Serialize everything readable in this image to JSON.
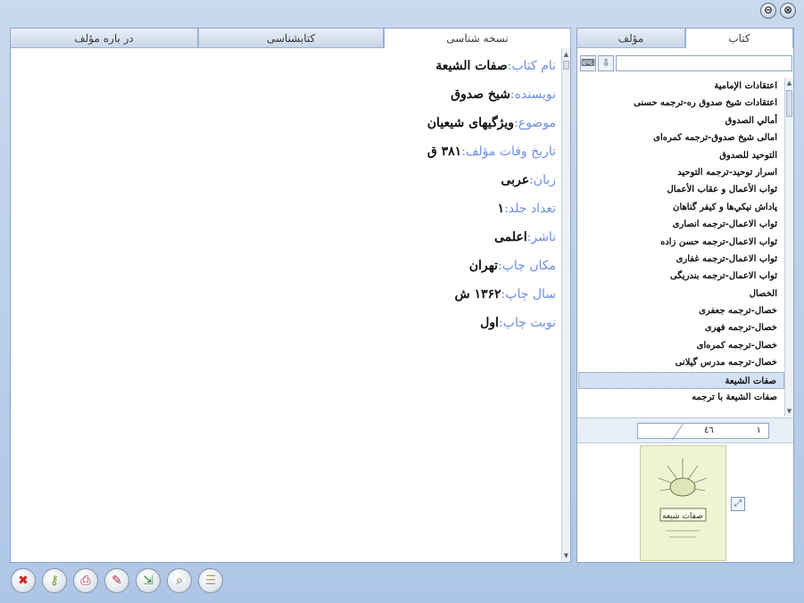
{
  "window": {
    "minimize_glyph": "⊖",
    "close_glyph": "⊗"
  },
  "left_tabs": [
    "در باره مؤلف",
    "کتابشناسی",
    "نسخه شناسی"
  ],
  "right_tabs": [
    "مؤلف",
    "کتاب"
  ],
  "book_info": [
    {
      "label": "نام کتاب:",
      "value": "صفات الشيعة"
    },
    {
      "label": "نویسنده:",
      "value": "شیخ صدوق"
    },
    {
      "label": "موضوع:",
      "value": "ویژگیهای شیعیان"
    },
    {
      "label": "تاریخ وفات مؤلف:",
      "value": "۳۸۱ ق"
    },
    {
      "label": "زبان:",
      "value": "عربی"
    },
    {
      "label": "تعداد جلد:",
      "value": "۱"
    },
    {
      "label": "ناشر:",
      "value": "اعلمی"
    },
    {
      "label": "مکان چاپ:",
      "value": "تهران"
    },
    {
      "label": "سال چاپ:",
      "value": "۱۳۶۲ ش"
    },
    {
      "label": "نوبت چاپ:",
      "value": "اول"
    }
  ],
  "search": {
    "placeholder": "",
    "value": ""
  },
  "book_list": [
    "اعتقادات الإمامية",
    "اعتقادات شيخ صدوق ره-ترجمه حسنی",
    "أمالي الصدوق",
    "امالی شيخ صدوق-ترجمه كمره‌ای",
    "التوحيد للصدوق",
    "اسرار توحيد-ترجمه التوحيد",
    "ثواب الأعمال و عقاب الأعمال",
    "پاداش نيكي‌ها و كيفر گناهان",
    "ثواب الاعمال-ترجمه انصاری",
    "ثواب الاعمال-ترجمه حسن زاده",
    "ثواب الاعمال-ترجمه غفاری",
    "ثواب الاعمال-ترجمه بندريگی",
    "الخصال",
    "خصال-ترجمه جعفری",
    "خصال-ترجمه فهری",
    "خصال-ترجمه كمره‌ای",
    "خصال-ترجمه مدرس گيلانی",
    "صفات الشيعة",
    "صفات الشيعة با ترجمه"
  ],
  "selected_index": 17,
  "pager": {
    "total": "٤٦",
    "current": "١"
  },
  "cover": {
    "title_text": "صفات شیعه"
  },
  "toolbar": [
    {
      "icon": "close-icon",
      "glyph": "✖",
      "color": "#d21e1e"
    },
    {
      "icon": "key-icon",
      "glyph": "⚷",
      "color": "#7a9a1c"
    },
    {
      "icon": "print-icon",
      "glyph": "⎙",
      "color": "#b0304a"
    },
    {
      "icon": "edit-icon",
      "glyph": "✎",
      "color": "#b0304a"
    },
    {
      "icon": "export-icon",
      "glyph": "⇲",
      "color": "#2f8a3a"
    },
    {
      "icon": "search-icon",
      "glyph": "⌕",
      "color": "#7a5c2a"
    },
    {
      "icon": "notes-icon",
      "glyph": "☰",
      "color": "#a8a060"
    }
  ]
}
